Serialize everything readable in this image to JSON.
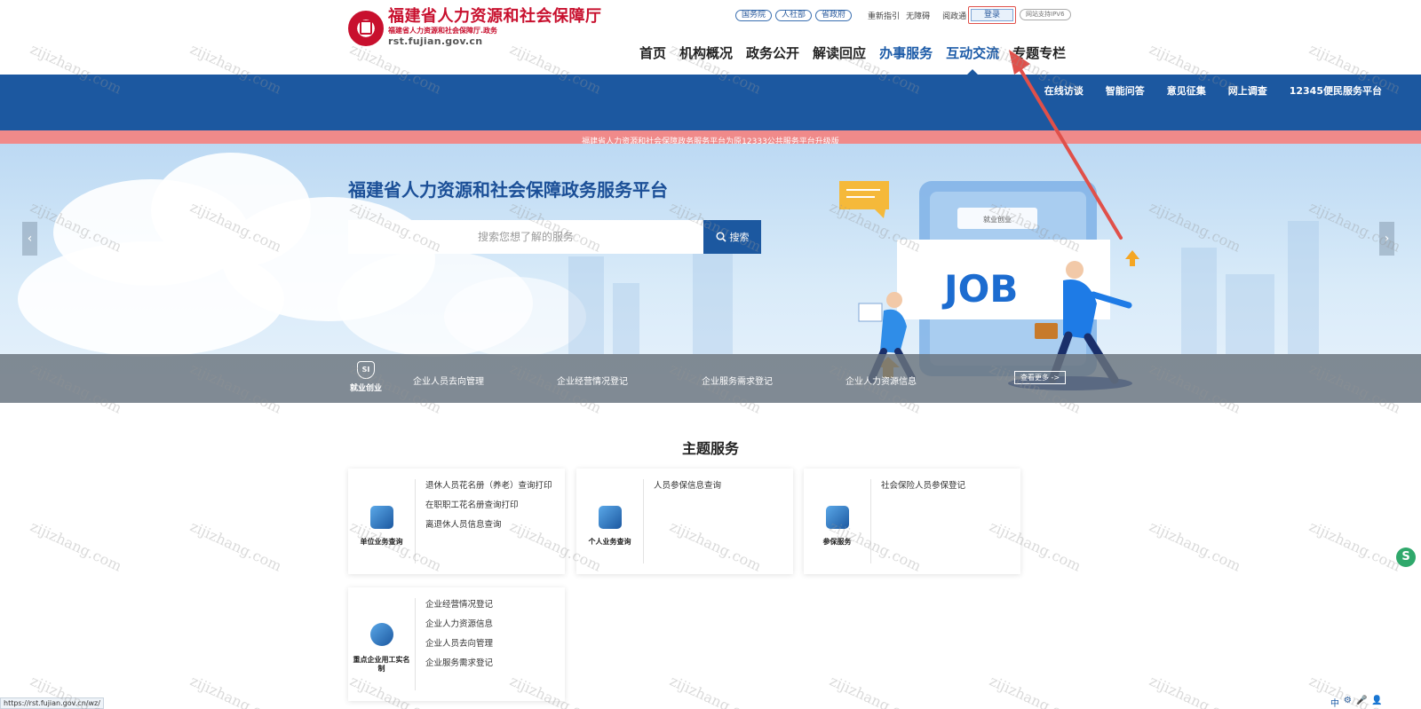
{
  "header": {
    "title": "福建省人力资源和社会保障厅",
    "subtitle": "福建省人力资源和社会保障厅.政务",
    "domain": "rst.fujian.gov.cn",
    "top_pills": [
      "国务院",
      "人社部",
      "省政府"
    ],
    "top_links": [
      "重新指引",
      "无障碍",
      "阅政通"
    ],
    "login_label": "登录",
    "ipv6_label": "网站支持IPV6"
  },
  "main_nav": [
    "首页",
    "机构概况",
    "政务公开",
    "解读回应",
    "办事服务",
    "互动交流",
    "专题专栏"
  ],
  "sub_nav": [
    "在线访谈",
    "智能问答",
    "意见征集",
    "网上调查",
    "12345便民服务平台"
  ],
  "notice": "福建省人力资源和社会保障政务服务平台为原12333公共服务平台升级版",
  "hero": {
    "title": "福建省人力资源和社会保障政务服务平台",
    "search_placeholder": "搜索您想了解的服务",
    "search_button": "搜索",
    "prev_arrow": "‹",
    "next_arrow": "›",
    "illustration_tag": "就业创业",
    "illustration_word": "JOB"
  },
  "category_band": {
    "category_icon_text": "SI",
    "category_label": "就业创业",
    "links": [
      "企业人员去向管理",
      "企业经营情况登记",
      "企业服务需求登记",
      "企业人力资源信息"
    ],
    "more_label": "查看更多 ->"
  },
  "theme_services": {
    "title": "主题服务",
    "cards": [
      {
        "icon": "file-icon",
        "label": "单位业务查询",
        "links": [
          "退休人员花名册（养老）查询打印",
          "在职职工花名册查询打印",
          "离退休人员信息查询"
        ]
      },
      {
        "icon": "person-icon",
        "label": "个人业务查询",
        "links": [
          "人员参保信息查询"
        ]
      },
      {
        "icon": "yuan-icon",
        "label": "参保服务",
        "links": [
          "社会保险人员参保登记"
        ]
      },
      {
        "icon": "monitor-icon",
        "label": "重点企业用工实名制",
        "links": [
          "企业经营情况登记",
          "企业人力资源信息",
          "企业人员去向管理",
          "企业服务需求登记"
        ]
      }
    ]
  },
  "status_url": "https://rst.fujian.gov.cn/wz/",
  "tray": [
    "中",
    "⚙",
    "🎤",
    "👤"
  ],
  "watermark": "zijizhang.com",
  "colors": {
    "primary_blue": "#1c58a0",
    "brand_red": "#c8102e",
    "notice_pink": "#f08a8a",
    "annotation_red": "#e0504a"
  }
}
